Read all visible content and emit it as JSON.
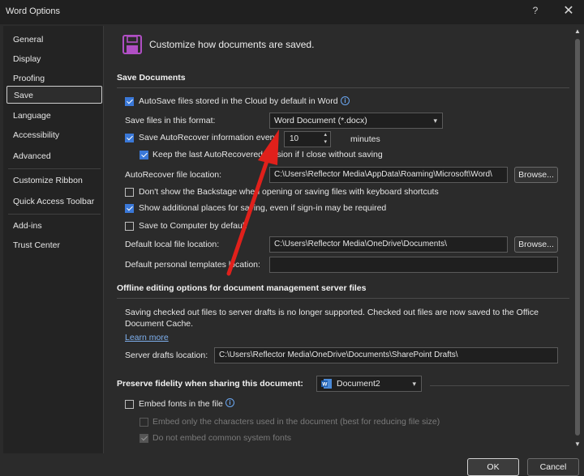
{
  "window": {
    "title": "Word Options",
    "help_glyph": "?",
    "close_glyph": "✕"
  },
  "sidebar": {
    "items": [
      {
        "label": "General"
      },
      {
        "label": "Display"
      },
      {
        "label": "Proofing"
      },
      {
        "label": "Save",
        "active": true
      },
      {
        "label": "Language"
      },
      {
        "label": "Accessibility"
      },
      {
        "label": "Advanced"
      },
      {
        "label": "Customize Ribbon"
      },
      {
        "label": "Quick Access Toolbar"
      },
      {
        "label": "Add-ins"
      },
      {
        "label": "Trust Center"
      }
    ]
  },
  "header": {
    "icon": "save-icon",
    "text": "Customize how documents are saved."
  },
  "save_documents": {
    "title": "Save Documents",
    "autosave_label": "AutoSave files stored in the Cloud by default in Word",
    "autosave_checked": true,
    "format_label": "Save files in this format:",
    "format_value": "Word Document (*.docx)",
    "autorecover_label": "Save AutoRecover information every",
    "autorecover_checked": true,
    "autorecover_minutes": "10",
    "minutes_label": "minutes",
    "keep_last_label": "Keep the last AutoRecovered version if I close without saving",
    "keep_last_checked": true,
    "autorecover_location_label": "AutoRecover file location:",
    "autorecover_location_value": "C:\\Users\\Reflector Media\\AppData\\Roaming\\Microsoft\\Word\\",
    "browse_label": "Browse...",
    "backstage_label": "Don't show the Backstage when opening or saving files with keyboard shortcuts",
    "backstage_checked": false,
    "additional_places_label": "Show additional places for saving, even if sign-in may be required",
    "additional_places_checked": true,
    "save_computer_label": "Save to Computer by default",
    "save_computer_checked": false,
    "default_local_label": "Default local file location:",
    "default_local_value": "C:\\Users\\Reflector Media\\OneDrive\\Documents\\",
    "browse2_label": "Browse...",
    "personal_templates_label": "Default personal templates location:",
    "personal_templates_value": ""
  },
  "offline": {
    "title": "Offline editing options for document management server files",
    "info_text_line1": "Saving checked out files to server drafts is no longer supported. Checked out files are now saved to the Office",
    "info_text_line2": "Document Cache.",
    "learn_more": "Learn more",
    "server_drafts_label": "Server drafts location:",
    "server_drafts_value": "C:\\Users\\Reflector Media\\OneDrive\\Documents\\SharePoint Drafts\\"
  },
  "fidelity": {
    "title": "Preserve fidelity when sharing this document:",
    "document_value": "Document2",
    "embed_fonts_label": "Embed fonts in the file",
    "embed_fonts_checked": false,
    "embed_only_label": "Embed only the characters used in the document (best for reducing file size)",
    "do_not_embed_label": "Do not embed common system fonts"
  },
  "footer": {
    "ok": "OK",
    "cancel": "Cancel"
  },
  "colors": {
    "accent_blue": "#3a78d8",
    "annotation_red": "#e0201b",
    "save_icon_purple": "#b04fc4"
  }
}
